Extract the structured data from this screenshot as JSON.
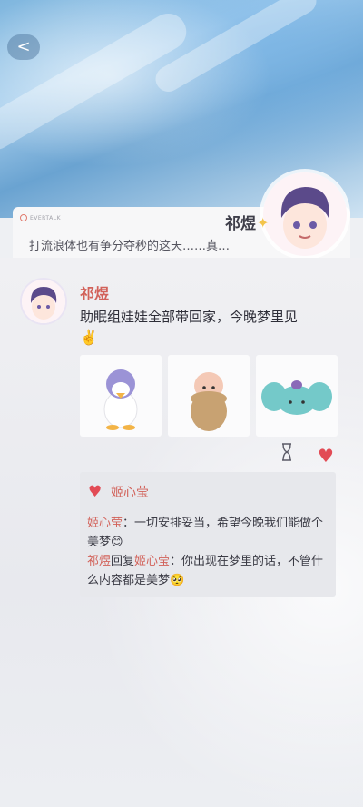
{
  "nav": {
    "back_label": "<"
  },
  "header": {
    "brand": "EVERTALK",
    "name": "祁煜",
    "status": "打流浪体也有争分夺秒的这天……真…"
  },
  "post": {
    "author": "祁煜",
    "text": "助眠组娃娃全部带回家，今晚梦里见",
    "emoji": "✌️",
    "photos": [
      "duck-doll-photo",
      "peanut-doll-photo",
      "elephant-doll-photo"
    ],
    "like_icon": "heart-icon",
    "timer_icon": "hourglass-icon"
  },
  "replies": {
    "liker": "姬心莹",
    "comments": [
      {
        "from": "姬心莹",
        "text": "：一切安排妥当，希望今晚我们能做个美梦😊"
      },
      {
        "from": "祁煜",
        "verb": "回复",
        "to": "姬心莹",
        "text": "：你出现在梦里的话，不管什么内容都是美梦🥺"
      }
    ]
  },
  "colors": {
    "accent": "#d2625a",
    "like": "#e24b55",
    "brand": "#e07a6e"
  }
}
